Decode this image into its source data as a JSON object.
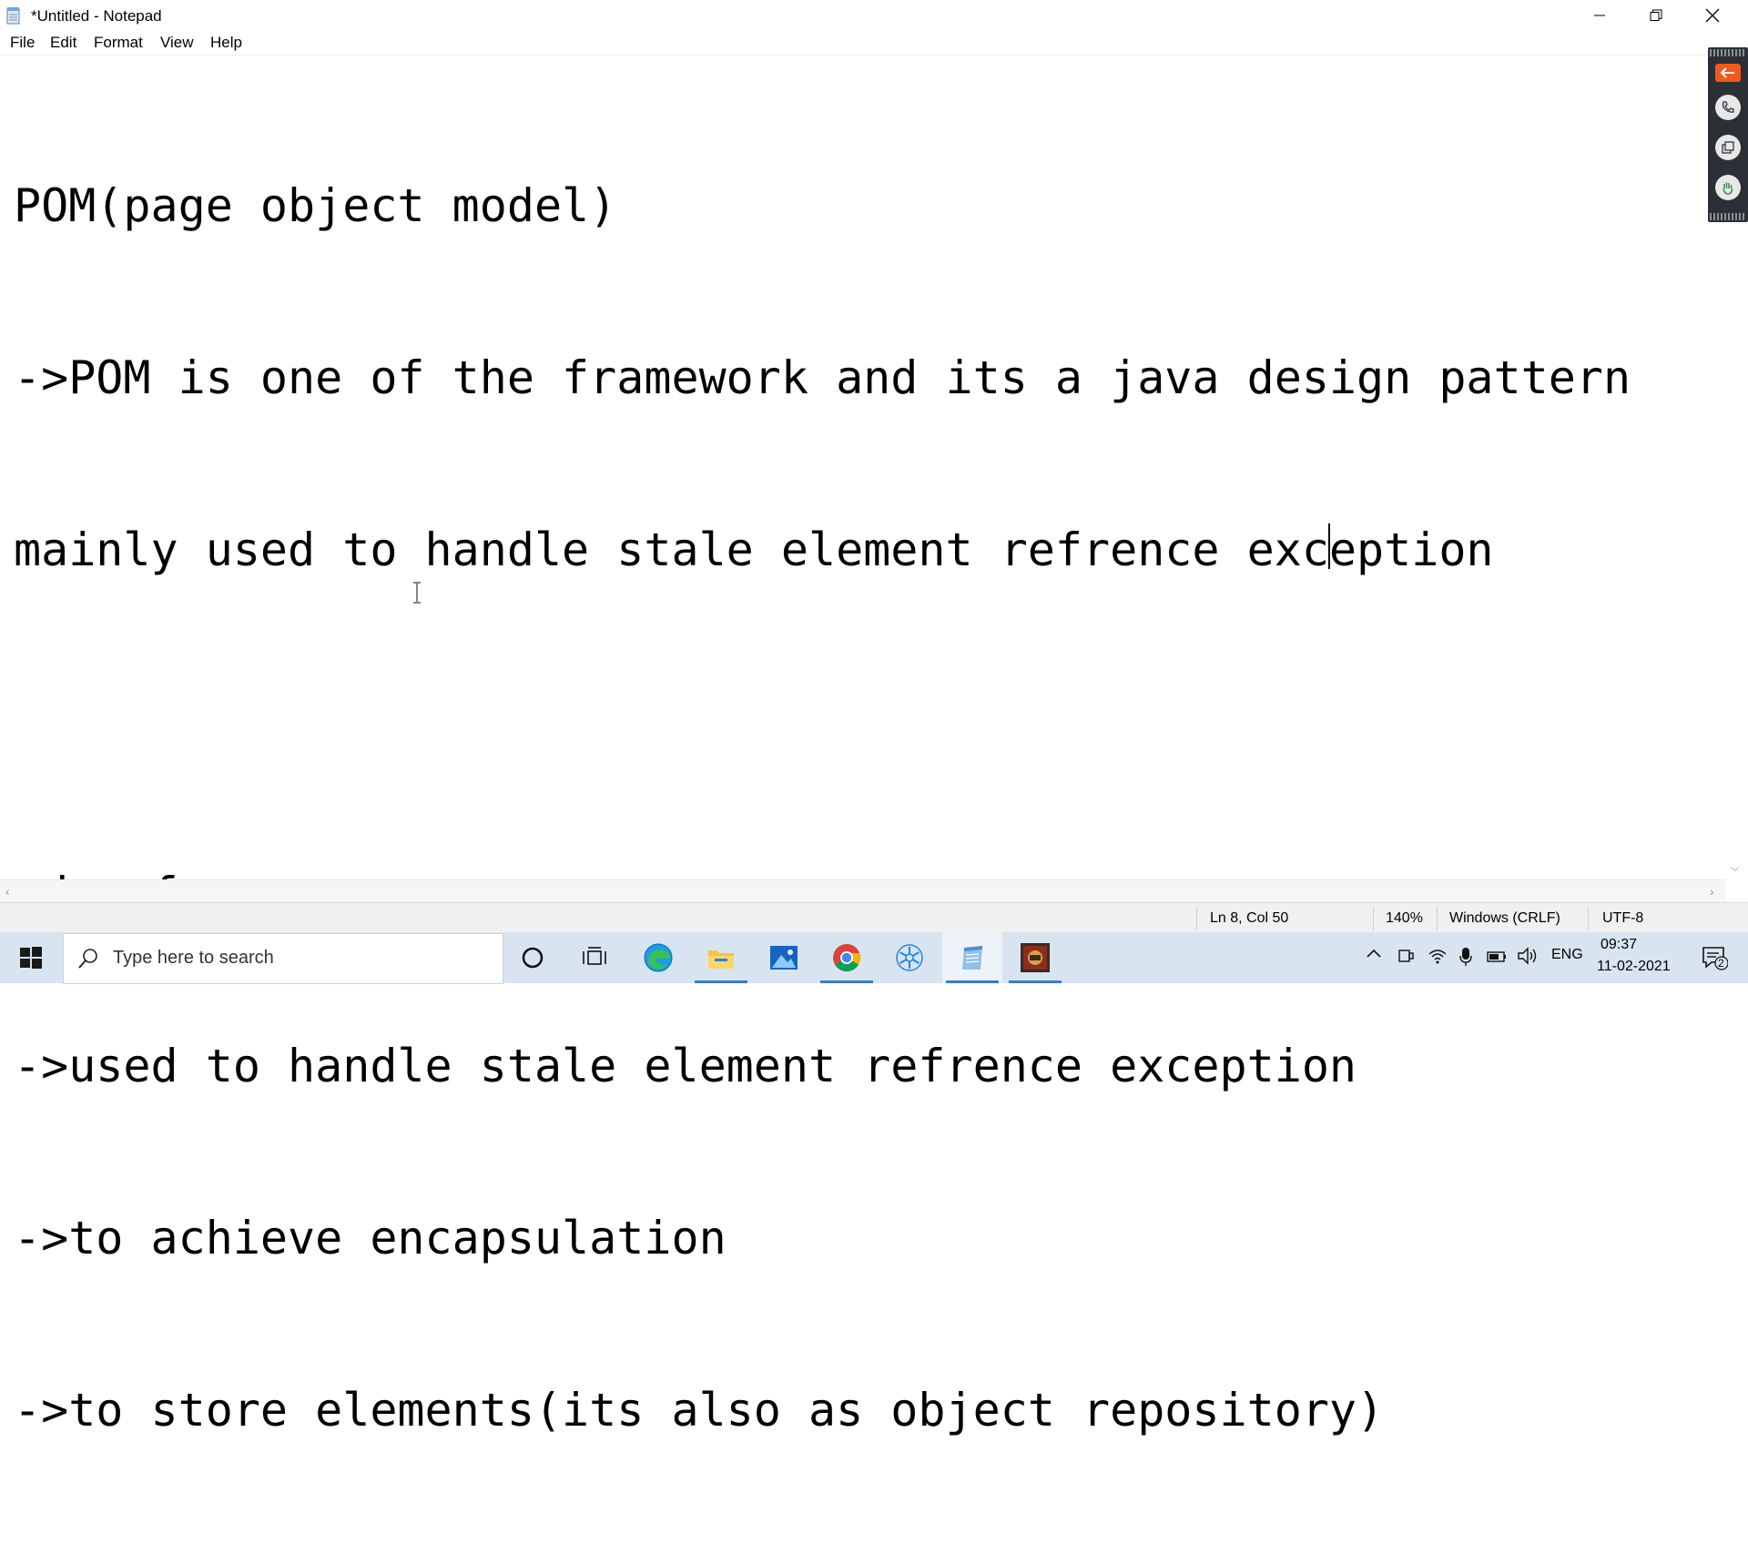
{
  "window": {
    "title": "*Untitled - Notepad",
    "controls": {
      "minimize": "minimize",
      "maximize": "restore",
      "close": "close"
    }
  },
  "menu": [
    "File",
    "Edit",
    "Format",
    "View",
    "Help"
  ],
  "editor": {
    "lines": [
      "POM(page object model)",
      "->POM is one of the framework and its a java design pattern",
      "mainly used to handle stale element refrence exception",
      "",
      "adv of pom",
      "->used to handle stale element refrence exception",
      "->to achieve encapsulation",
      "->to store elements(its also as object repository)"
    ]
  },
  "status": {
    "position": "Ln 8, Col 50",
    "zoom": "140%",
    "line_ending": "Windows (CRLF)",
    "encoding": "UTF-8"
  },
  "taskbar": {
    "search_placeholder": "Type here to search",
    "apps": [
      "cortana-icon",
      "task-view-icon",
      "edge-icon",
      "file-explorer-icon",
      "photos-icon",
      "chrome-icon",
      "snowflake-app-icon",
      "notepad-icon",
      "game-app-icon"
    ],
    "tray": {
      "language": "ENG",
      "time": "09:37",
      "date": "11-02-2021",
      "notification_count": "2"
    }
  },
  "colors": {
    "taskbar_bg": "#d9e4f1",
    "accent": "#3a7bd5",
    "side_panel": "#2b2f36",
    "side_arrow": "#f05a1a"
  }
}
